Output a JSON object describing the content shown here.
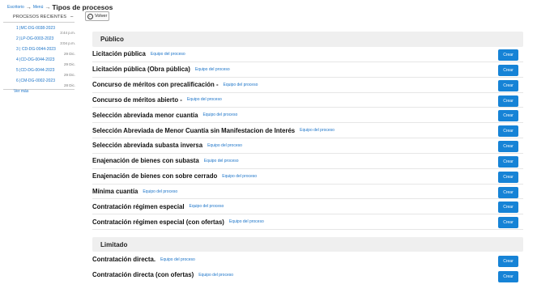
{
  "breadcrumb": {
    "items": [
      "Escritorio",
      "Menú"
    ],
    "separator": "→",
    "current": "Tipos de procesos"
  },
  "back_button": {
    "label": "Volver",
    "icon": "arrow-left-circle-icon"
  },
  "sidebar": {
    "title": "PROCESOS RECIENTES",
    "collapse_symbol": "–",
    "items": [
      {
        "name": "1 |MC-DG-0038-2023",
        "date": "3:44 p.m."
      },
      {
        "name": "2 |LP-DG-0003-2023",
        "date": "3:04 p.m."
      },
      {
        "name": "3 | CD-DG-0044-2023",
        "date": "29 Dic."
      },
      {
        "name": "4 |CD-DG-0044-2023",
        "date": "29 Dic."
      },
      {
        "name": "5 |CD-DG-0044-2023",
        "date": "29 Dic."
      },
      {
        "name": "6 |CM-DG-0002-2023",
        "date": "28 Dic."
      }
    ],
    "see_more": "Ver más"
  },
  "team_link": "Equipo del proceso",
  "create_label": "Crear",
  "accent_color": "#1683d6",
  "sections": [
    {
      "title": "Público",
      "processes": [
        "Licitación pública",
        "Licitación pública (Obra pública)",
        "Concurso de méritos con precalificación -",
        "Concurso de méritos abierto -",
        "Selección abreviada menor cuantía",
        "Selección Abreviada de Menor Cuantía sin Manifestacion de Interés",
        "Selección abreviada subasta inversa",
        "Enajenación de bienes con subasta",
        "Enajenación de bienes con sobre cerrado",
        "Mínima cuantía",
        "Contratación régimen especial",
        "Contratación régimen especial (con ofertas)"
      ]
    },
    {
      "title": "Limitado",
      "processes": [
        "Contratación directa.",
        "Contratación directa (con ofertas)"
      ]
    }
  ]
}
